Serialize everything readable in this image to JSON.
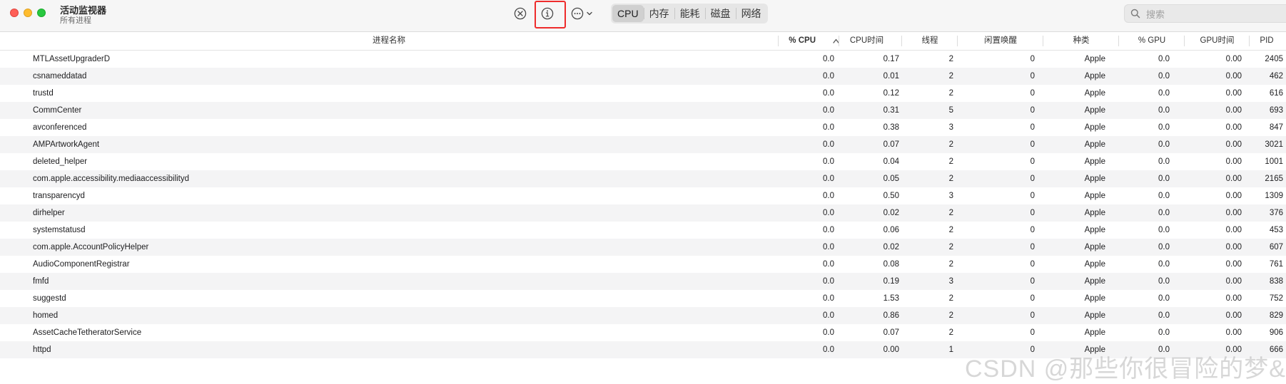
{
  "app": {
    "title": "活动监视器",
    "subtitle": "所有进程"
  },
  "toolbar": {
    "stop_icon": "xmark-circle-icon",
    "info_icon": "info-circle-icon",
    "more_icon": "ellipsis-circle-icon",
    "tabs": [
      "CPU",
      "内存",
      "能耗",
      "磁盘",
      "网络"
    ],
    "active_tab": "CPU"
  },
  "search": {
    "placeholder": "搜索"
  },
  "columns": {
    "name": "进程名称",
    "cpu": "% CPU",
    "cpu_time": "CPU时间",
    "threads": "线程",
    "idle_wake": "闲置唤醒",
    "kind": "种类",
    "gpu": "% GPU",
    "gpu_time": "GPU时间",
    "pid": "PID"
  },
  "rows": [
    {
      "name": "MTLAssetUpgraderD",
      "cpu": "0.0",
      "cpu_time": "0.17",
      "threads": "2",
      "idle_wake": "0",
      "kind": "Apple",
      "gpu": "0.0",
      "gpu_time": "0.00",
      "pid": "2405"
    },
    {
      "name": "csnameddatad",
      "cpu": "0.0",
      "cpu_time": "0.01",
      "threads": "2",
      "idle_wake": "0",
      "kind": "Apple",
      "gpu": "0.0",
      "gpu_time": "0.00",
      "pid": "462"
    },
    {
      "name": "trustd",
      "cpu": "0.0",
      "cpu_time": "0.12",
      "threads": "2",
      "idle_wake": "0",
      "kind": "Apple",
      "gpu": "0.0",
      "gpu_time": "0.00",
      "pid": "616"
    },
    {
      "name": "CommCenter",
      "cpu": "0.0",
      "cpu_time": "0.31",
      "threads": "5",
      "idle_wake": "0",
      "kind": "Apple",
      "gpu": "0.0",
      "gpu_time": "0.00",
      "pid": "693"
    },
    {
      "name": "avconferenced",
      "cpu": "0.0",
      "cpu_time": "0.38",
      "threads": "3",
      "idle_wake": "0",
      "kind": "Apple",
      "gpu": "0.0",
      "gpu_time": "0.00",
      "pid": "847"
    },
    {
      "name": "AMPArtworkAgent",
      "cpu": "0.0",
      "cpu_time": "0.07",
      "threads": "2",
      "idle_wake": "0",
      "kind": "Apple",
      "gpu": "0.0",
      "gpu_time": "0.00",
      "pid": "3021"
    },
    {
      "name": "deleted_helper",
      "cpu": "0.0",
      "cpu_time": "0.04",
      "threads": "2",
      "idle_wake": "0",
      "kind": "Apple",
      "gpu": "0.0",
      "gpu_time": "0.00",
      "pid": "1001"
    },
    {
      "name": "com.apple.accessibility.mediaaccessibilityd",
      "cpu": "0.0",
      "cpu_time": "0.05",
      "threads": "2",
      "idle_wake": "0",
      "kind": "Apple",
      "gpu": "0.0",
      "gpu_time": "0.00",
      "pid": "2165"
    },
    {
      "name": "transparencyd",
      "cpu": "0.0",
      "cpu_time": "0.50",
      "threads": "3",
      "idle_wake": "0",
      "kind": "Apple",
      "gpu": "0.0",
      "gpu_time": "0.00",
      "pid": "1309"
    },
    {
      "name": "dirhelper",
      "cpu": "0.0",
      "cpu_time": "0.02",
      "threads": "2",
      "idle_wake": "0",
      "kind": "Apple",
      "gpu": "0.0",
      "gpu_time": "0.00",
      "pid": "376"
    },
    {
      "name": "systemstatusd",
      "cpu": "0.0",
      "cpu_time": "0.06",
      "threads": "2",
      "idle_wake": "0",
      "kind": "Apple",
      "gpu": "0.0",
      "gpu_time": "0.00",
      "pid": "453"
    },
    {
      "name": "com.apple.AccountPolicyHelper",
      "cpu": "0.0",
      "cpu_time": "0.02",
      "threads": "2",
      "idle_wake": "0",
      "kind": "Apple",
      "gpu": "0.0",
      "gpu_time": "0.00",
      "pid": "607"
    },
    {
      "name": "AudioComponentRegistrar",
      "cpu": "0.0",
      "cpu_time": "0.08",
      "threads": "2",
      "idle_wake": "0",
      "kind": "Apple",
      "gpu": "0.0",
      "gpu_time": "0.00",
      "pid": "761"
    },
    {
      "name": "fmfd",
      "cpu": "0.0",
      "cpu_time": "0.19",
      "threads": "3",
      "idle_wake": "0",
      "kind": "Apple",
      "gpu": "0.0",
      "gpu_time": "0.00",
      "pid": "838"
    },
    {
      "name": "suggestd",
      "cpu": "0.0",
      "cpu_time": "1.53",
      "threads": "2",
      "idle_wake": "0",
      "kind": "Apple",
      "gpu": "0.0",
      "gpu_time": "0.00",
      "pid": "752"
    },
    {
      "name": "homed",
      "cpu": "0.0",
      "cpu_time": "0.86",
      "threads": "2",
      "idle_wake": "0",
      "kind": "Apple",
      "gpu": "0.0",
      "gpu_time": "0.00",
      "pid": "829"
    },
    {
      "name": "AssetCacheTetheratorService",
      "cpu": "0.0",
      "cpu_time": "0.07",
      "threads": "2",
      "idle_wake": "0",
      "kind": "Apple",
      "gpu": "0.0",
      "gpu_time": "0.00",
      "pid": "906"
    },
    {
      "name": "httpd",
      "cpu": "0.0",
      "cpu_time": "0.00",
      "threads": "1",
      "idle_wake": "0",
      "kind": "Apple",
      "gpu": "0.0",
      "gpu_time": "0.00",
      "pid": "666"
    }
  ],
  "watermark": "CSDN @那些你很冒险的梦&"
}
